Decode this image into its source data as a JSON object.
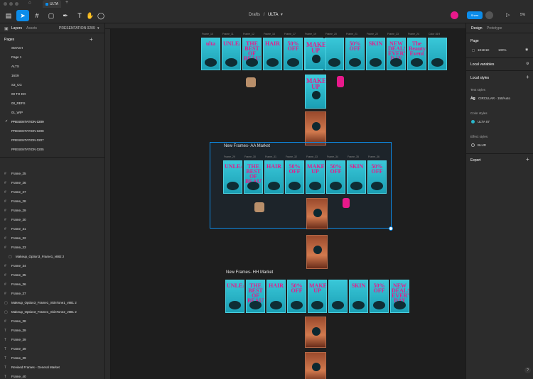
{
  "toolbar": {
    "doc_path": "Drafts",
    "doc_sep": "/",
    "doc_name": "ULTA",
    "tab_name": "ULTA",
    "share_label": "Share",
    "zoom": "5%"
  },
  "left_panel": {
    "tabs": [
      "Layers",
      "Assets"
    ],
    "current_page": "PRESENTATION 0209",
    "pages_title": "Pages",
    "pages": [
      "SMASH",
      "Page 1",
      "ALTS",
      "16X9",
      "S3_CG",
      "00 TO DO",
      "00_REFS",
      "01_WIP",
      "PRESENTATION 0209",
      "PRESENTATION 0208",
      "PRESENTATION 0207",
      "PRESENTATION 0205"
    ],
    "layers": [
      {
        "icon": "#",
        "label": "Frame_25"
      },
      {
        "icon": "#",
        "label": "Frame_26"
      },
      {
        "icon": "#",
        "label": "Frame_27"
      },
      {
        "icon": "#",
        "label": "Frame_28"
      },
      {
        "icon": "#",
        "label": "Frame_29"
      },
      {
        "icon": "#",
        "label": "Frame_30"
      },
      {
        "icon": "#",
        "label": "Frame_31"
      },
      {
        "icon": "#",
        "label": "Frame_32"
      },
      {
        "icon": "#",
        "label": "Frame_33"
      },
      {
        "icon": "▢",
        "label": "Makeup_Option3_Frame1_v882 2"
      },
      {
        "icon": "#",
        "label": "Frame_34"
      },
      {
        "icon": "#",
        "label": "Frame_35"
      },
      {
        "icon": "#",
        "label": "Frame_36"
      },
      {
        "icon": "#",
        "label": "Frame_37"
      },
      {
        "icon": "▢",
        "label": "Makeup_Option3_Frame1_SkinTone1_v881 2"
      },
      {
        "icon": "▢",
        "label": "Makeup_Option3_Frame1_SkinTone2_v881 2"
      },
      {
        "icon": "#",
        "label": "Frame_38"
      },
      {
        "icon": "T",
        "label": "Frame_39"
      },
      {
        "icon": "T",
        "label": "Frame_39"
      },
      {
        "icon": "T",
        "label": "Frame_39"
      },
      {
        "icon": "T",
        "label": "Frame_39"
      },
      {
        "icon": "T",
        "label": "Revised Frames - General Market"
      },
      {
        "icon": "T",
        "label": "Frame_40"
      }
    ]
  },
  "right_panel": {
    "tabs": [
      "Design",
      "Prototype"
    ],
    "page_section": "Page",
    "page_color": "1E1E1E",
    "page_opacity": "100%",
    "local_variables": "Local variables",
    "local_styles": "Local styles",
    "text_styles": "Text styles",
    "text_style_preview": "Ag",
    "text_style_name": "CIRCULAR · 150/Auto",
    "color_styles": "Color styles",
    "color_style_name": "ULTA 07",
    "effect_styles": "Effect styles",
    "effect_style_name": "BLUR",
    "export": "Export"
  },
  "canvas": {
    "section_aa": "New Frames- AA Market",
    "section_hh": "New Frames- HH Market",
    "top_frame_labels": [
      "Frame_10",
      "Frame_11",
      "Frame_12",
      "Frame_16",
      "Frame_17",
      "Frame_19",
      "Frame_20",
      "Frame_21",
      "Frame_22",
      "Frame_23",
      "Frame_24",
      "Color 16:9"
    ],
    "aa_frame_labels": [
      "Frame_29",
      "Frame_30",
      "Frame_31",
      "Frame_32",
      "Frame_33",
      "Frame_34",
      "Frame_35",
      "Frame_36"
    ],
    "frame_texts": [
      "ulta",
      "UNLEASH",
      "THE BEST OF BEAUTY",
      "HAIR",
      "50% OFF",
      "MAKE UP",
      "",
      "50% OFF",
      "SKIN",
      "NEW DEALS EVERY DAY",
      "The Beauty Event",
      ""
    ],
    "aa_texts": [
      "UNLEASH",
      "THE BEST OF BEAUTY",
      "HAIR",
      "50% OFF",
      "MAKE UP",
      "50% OFF",
      "SKIN",
      "50% OFF"
    ],
    "hh_texts": [
      "UNLEASH",
      "THE BEST OF BEAUTY",
      "HAIR",
      "50% OFF",
      "MAKE UP",
      "",
      "SKIN",
      "50% OFF",
      "NEW DEALS EVERY DAY"
    ],
    "tall_text": "MAKE UP"
  },
  "colors": {
    "accent": "#0c8ce9",
    "brand_pink": "#e8198b",
    "frame_teal": "#2bb7cb"
  }
}
